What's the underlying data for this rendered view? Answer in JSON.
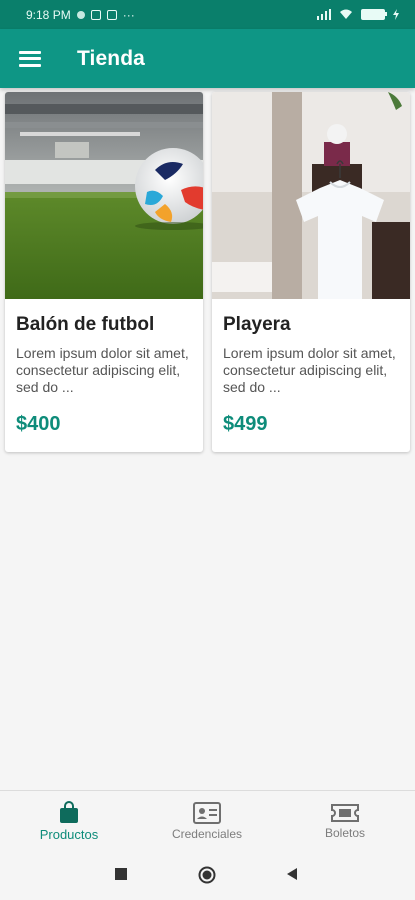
{
  "status_bar": {
    "time": "9:18 PM",
    "battery": "100"
  },
  "app_bar": {
    "title": "Tienda"
  },
  "products": [
    {
      "name": "Balón de futbol",
      "description": "Lorem ipsum dolor sit amet, consectetur adipiscing elit, sed do ...",
      "price": "$400"
    },
    {
      "name": "Playera",
      "description": "Lorem ipsum dolor sit amet, consectetur adipiscing elit, sed do ...",
      "price": "$499"
    }
  ],
  "bottom_nav": {
    "items": [
      {
        "label": "Productos",
        "icon": "shopping-bag-icon",
        "active": true
      },
      {
        "label": "Credenciales",
        "icon": "id-card-icon",
        "active": false
      },
      {
        "label": "Boletos",
        "icon": "ticket-icon",
        "active": false
      }
    ]
  },
  "colors": {
    "primary": "#0e9685",
    "status_bar": "#0a7f6b",
    "accent_text": "#0e8c7a"
  }
}
